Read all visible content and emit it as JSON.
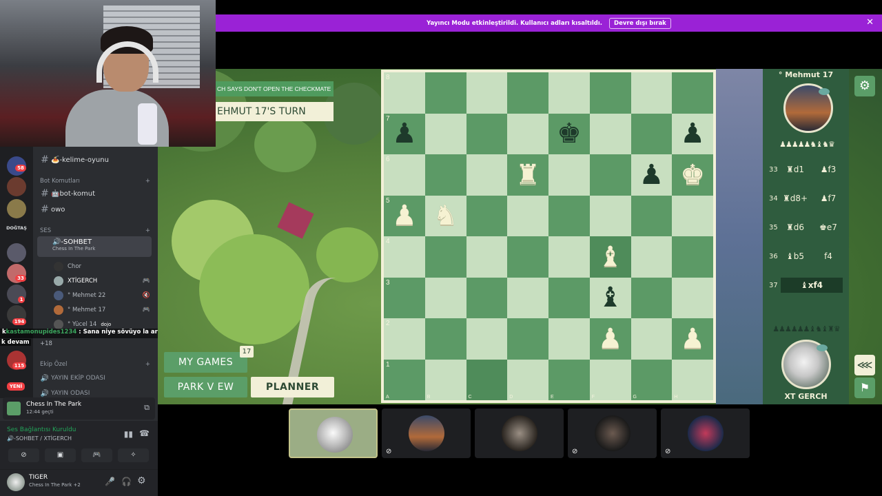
{
  "banner": {
    "text": "Yayıncı Modu etkinleştirildi. Kullanıcı adları kısaltıldı.",
    "button": "Devre dışı bırak",
    "close": "✕"
  },
  "discord": {
    "guild_badges": [
      "58",
      "33",
      "1",
      "194",
      "115"
    ],
    "guild_label": "DOĞTAŞ",
    "guild_new": "YENİ",
    "channels": {
      "kelime": "🍝-kelime-oyunu",
      "bot_category": "Bot Komutları",
      "bot_komut": "🤖bot-komut",
      "owo": "owo",
      "ses_category": "SES",
      "sohbet": "🔊-SOHBET",
      "sohbet_activity": "Chess In The Park",
      "ekip_category": "Ekip Özel",
      "ekip_odasi": "YAYIN EKİP ODASI",
      "yayin_odasi": "YAYIN ODASI",
      "more_users": "+18"
    },
    "voice_users": [
      "Chor",
      "XTİGERCH",
      "° Mehmet 22",
      "° Mehmet 17",
      "° Yücel 14"
    ],
    "dojo": "dojo",
    "chat": {
      "user": "kastamonupides1234",
      "message": " : Sana niye sövüyo la arkadaki",
      "prefix": "k",
      "second_line": "k devam"
    },
    "activity": {
      "title": "Chess In The Park",
      "elapsed": "12:44 geçti"
    },
    "voice_connection": {
      "status": "Ses Bağlantısı Kuruldu",
      "channel": "🔊-SOHBET / XTİGERCH"
    },
    "user": {
      "name": "TIGER",
      "status": "Chess In The Park +2"
    }
  },
  "game": {
    "msg_banner": "CH SAYS DON'T OPEN THE CHECKMATE",
    "turn_banner": "EHMUT 17'S TURN",
    "my_games": "MY GAMES",
    "my_games_count": "17",
    "park_view": "PARK V EW",
    "planner": "PLANNER",
    "opponent_name": "° Mehmut 17",
    "opponent_captures": "♟♟♟♟♟♞♝♞♛",
    "my_captures": "♟♟♟♟♟♟♝♞♝♜♛",
    "me_name": "XT GERCH",
    "ranks": [
      "8",
      "7",
      "6",
      "5",
      "4",
      "3",
      "2",
      "1"
    ],
    "files": [
      "A",
      "B",
      "C",
      "D",
      "E",
      "F",
      "G",
      "H"
    ],
    "moves": [
      {
        "num": "33",
        "white": "♜d1",
        "black": "♟f3"
      },
      {
        "num": "34",
        "white": "♜d8+",
        "black": "♟f7"
      },
      {
        "num": "35",
        "white": "♜d6",
        "black": "♚e7"
      },
      {
        "num": "36",
        "white": "♝b5",
        "black": "f4"
      },
      {
        "num": "37",
        "white": "♝xf4",
        "black": ""
      }
    ]
  },
  "board": {
    "pieces": {
      "a7": {
        "glyph": "♟",
        "color": "b"
      },
      "e7": {
        "glyph": "♚",
        "color": "b"
      },
      "h7": {
        "glyph": "♟",
        "color": "b"
      },
      "d6": {
        "glyph": "♜",
        "color": "w"
      },
      "g6": {
        "glyph": "♟",
        "color": "b"
      },
      "h6": {
        "glyph": "♚",
        "color": "w"
      },
      "a5": {
        "glyph": "♟",
        "color": "w"
      },
      "b5": {
        "glyph": "♞",
        "color": "w"
      },
      "f4": {
        "glyph": "♝",
        "color": "w"
      },
      "f3": {
        "glyph": "♝",
        "color": "b"
      },
      "f2": {
        "glyph": "♟",
        "color": "w"
      },
      "h2": {
        "glyph": "♟",
        "color": "w"
      }
    },
    "highlights": [
      "f4",
      "c1"
    ]
  },
  "colors": {
    "banner": "#9a22d6",
    "board_light": "#c8dfc0",
    "board_dark": "#5c9a66",
    "panel": "#2f5c3e",
    "accent_green": "#5b9e68",
    "cream": "#f2f0d8"
  },
  "icons": {
    "settings": "gear-icon",
    "share": "share-icon",
    "flag": "flag-icon"
  }
}
